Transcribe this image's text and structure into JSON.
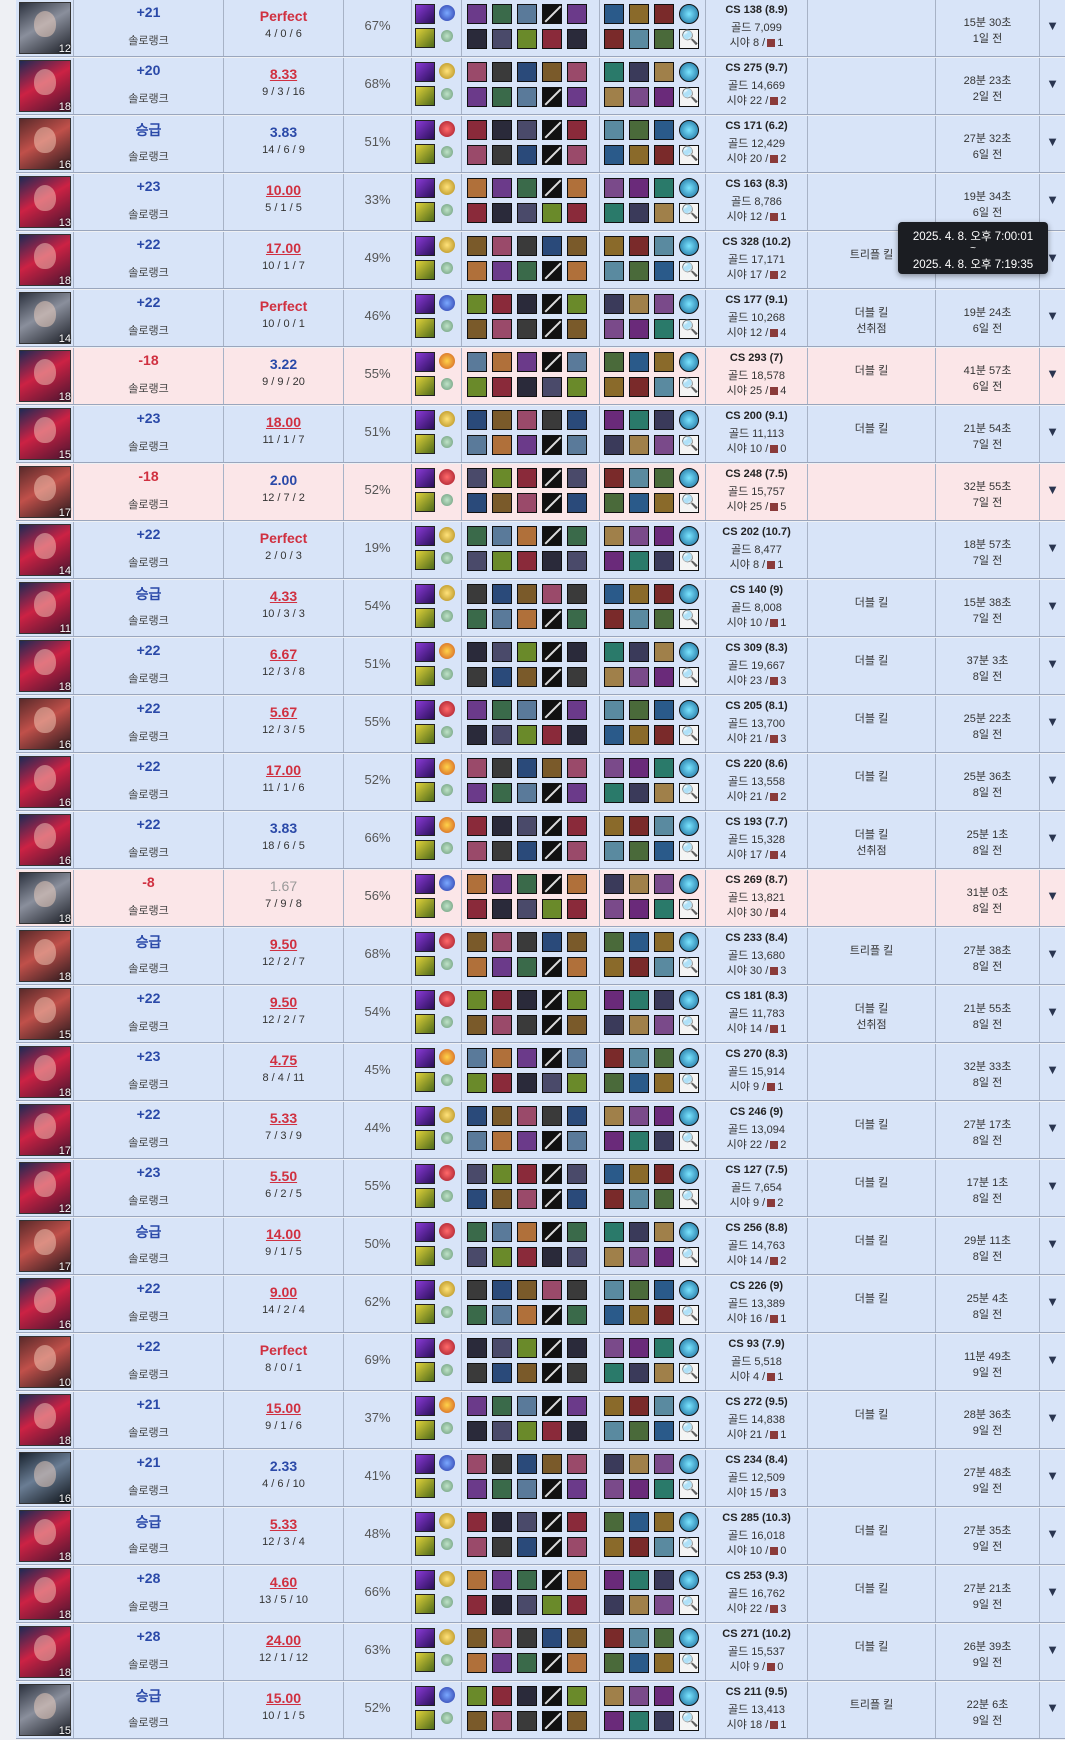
{
  "tooltip": {
    "start": "2025. 4. 8. 오후 7:00:01",
    "sep": "~",
    "end": "2025. 4. 8. 오후 7:19:35"
  },
  "colors": {
    "win_row": "#d8e4f8",
    "loss_row": "#fbe6e8",
    "lp_positive": "#2a49a8",
    "lp_negative": "#d03040",
    "kda_highlight": "#d03040"
  },
  "expand_icon": "▼",
  "matches": [
    {
      "result": "win",
      "champ": "lux",
      "level": "12",
      "lp": "+21",
      "queue": "솔로랭크",
      "kda_ratio": "Perfect",
      "kda_style": "perfect",
      "kda": "4 / 0 / 6",
      "kp": "67%",
      "rune": "sorcery",
      "cs": "CS 138 (8.9)",
      "gold": "골드 7,099",
      "vision": "시야 8 /",
      "wards": "1",
      "badge1": "",
      "badge2": "",
      "duration": "15분 30초",
      "ago": "1일 전"
    },
    {
      "result": "win",
      "champ": "zed",
      "level": "18",
      "lp": "+20",
      "queue": "솔로랭크",
      "kda_ratio": "8.33",
      "kda_style": "great",
      "kda": "9 / 3 / 16",
      "kp": "68%",
      "rune": "precision",
      "cs": "CS 275 (9.7)",
      "gold": "골드 14,669",
      "vision": "시야 22 /",
      "wards": "2",
      "badge1": "",
      "badge2": "",
      "duration": "28분 23초",
      "ago": "2일 전"
    },
    {
      "result": "win",
      "champ": "kat",
      "level": "16",
      "lp": "승급",
      "queue": "솔로랭크",
      "kda_ratio": "3.83",
      "kda_style": "normal",
      "kda": "14 / 6 / 9",
      "kp": "51%",
      "rune": "domination",
      "cs": "CS 171 (6.2)",
      "gold": "골드 12,429",
      "vision": "시야 20 /",
      "wards": "2",
      "badge1": "",
      "badge2": "",
      "duration": "27분 32초",
      "ago": "6일 전"
    },
    {
      "result": "win",
      "champ": "zed",
      "level": "13",
      "lp": "+23",
      "queue": "솔로랭크",
      "kda_ratio": "10.00",
      "kda_style": "great",
      "kda": "5 / 1 / 5",
      "kp": "33%",
      "rune": "precision",
      "cs": "CS 163 (8.3)",
      "gold": "골드 8,786",
      "vision": "시야 12 /",
      "wards": "1",
      "badge1": "",
      "badge2": "",
      "duration": "19분 34초",
      "ago": "6일 전"
    },
    {
      "result": "win",
      "champ": "zed",
      "level": "18",
      "lp": "+22",
      "queue": "솔로랭크",
      "kda_ratio": "17.00",
      "kda_style": "great",
      "kda": "10 / 1 / 7",
      "kp": "49%",
      "rune": "precision",
      "cs": "CS 328 (10.2)",
      "gold": "골드 17,171",
      "vision": "시야 17 /",
      "wards": "2",
      "badge1": "트리플 킬",
      "badge2": "",
      "duration": "",
      "ago": ""
    },
    {
      "result": "win",
      "champ": "lux",
      "level": "14",
      "lp": "+22",
      "queue": "솔로랭크",
      "kda_ratio": "Perfect",
      "kda_style": "perfect",
      "kda": "10 / 0 / 1",
      "kp": "46%",
      "rune": "sorcery",
      "cs": "CS 177 (9.1)",
      "gold": "골드 10,268",
      "vision": "시야 12 /",
      "wards": "4",
      "badge1": "더블 킬",
      "badge2": "선취점",
      "duration": "19분 24초",
      "ago": "6일 전"
    },
    {
      "result": "loss",
      "champ": "zed",
      "level": "18",
      "lp": "-18",
      "queue": "솔로랭크",
      "kda_ratio": "3.22",
      "kda_style": "normal",
      "kda": "9 / 9 / 20",
      "kp": "55%",
      "rune": "electro",
      "cs": "CS 293 (7)",
      "gold": "골드 18,578",
      "vision": "시야 25 /",
      "wards": "4",
      "badge1": "더블 킬",
      "badge2": "",
      "duration": "41분 57초",
      "ago": "6일 전"
    },
    {
      "result": "win",
      "champ": "zed",
      "level": "15",
      "lp": "+23",
      "queue": "솔로랭크",
      "kda_ratio": "18.00",
      "kda_style": "great",
      "kda": "11 / 1 / 7",
      "kp": "51%",
      "rune": "precision",
      "cs": "CS 200 (9.1)",
      "gold": "골드 11,113",
      "vision": "시야 10 /",
      "wards": "0",
      "badge1": "더블 킬",
      "badge2": "",
      "duration": "21분 54초",
      "ago": "7일 전"
    },
    {
      "result": "loss",
      "champ": "kat",
      "level": "17",
      "lp": "-18",
      "queue": "솔로랭크",
      "kda_ratio": "2.00",
      "kda_style": "normal",
      "kda": "12 / 7 / 2",
      "kp": "52%",
      "rune": "domination",
      "cs": "CS 248 (7.5)",
      "gold": "골드 15,757",
      "vision": "시야 25 /",
      "wards": "5",
      "badge1": "",
      "badge2": "",
      "duration": "32분 55초",
      "ago": "7일 전"
    },
    {
      "result": "win",
      "champ": "zed",
      "level": "14",
      "lp": "+22",
      "queue": "솔로랭크",
      "kda_ratio": "Perfect",
      "kda_style": "perfect",
      "kda": "2 / 0 / 3",
      "kp": "19%",
      "rune": "precision",
      "cs": "CS 202 (10.7)",
      "gold": "골드 8,477",
      "vision": "시야 8 /",
      "wards": "1",
      "badge1": "",
      "badge2": "",
      "duration": "18분 57초",
      "ago": "7일 전"
    },
    {
      "result": "win",
      "champ": "zed",
      "level": "11",
      "lp": "승급",
      "queue": "솔로랭크",
      "kda_ratio": "4.33",
      "kda_style": "great",
      "kda": "10 / 3 / 3",
      "kp": "54%",
      "rune": "precision",
      "cs": "CS 140 (9)",
      "gold": "골드 8,008",
      "vision": "시야 10 /",
      "wards": "1",
      "badge1": "더블 킬",
      "badge2": "",
      "duration": "15분 38초",
      "ago": "7일 전"
    },
    {
      "result": "win",
      "champ": "zed",
      "level": "18",
      "lp": "+22",
      "queue": "솔로랭크",
      "kda_ratio": "6.67",
      "kda_style": "great",
      "kda": "12 / 3 / 8",
      "kp": "51%",
      "rune": "electro",
      "cs": "CS 309 (8.3)",
      "gold": "골드 19,667",
      "vision": "시야 23 /",
      "wards": "3",
      "badge1": "더블 킬",
      "badge2": "",
      "duration": "37분 3초",
      "ago": "8일 전"
    },
    {
      "result": "win",
      "champ": "kat",
      "level": "16",
      "lp": "+22",
      "queue": "솔로랭크",
      "kda_ratio": "5.67",
      "kda_style": "great",
      "kda": "12 / 3 / 5",
      "kp": "55%",
      "rune": "domination",
      "cs": "CS 205 (8.1)",
      "gold": "골드 13,700",
      "vision": "시야 21 /",
      "wards": "3",
      "badge1": "더블 킬",
      "badge2": "",
      "duration": "25분 22초",
      "ago": "8일 전"
    },
    {
      "result": "win",
      "champ": "zed",
      "level": "16",
      "lp": "+22",
      "queue": "솔로랭크",
      "kda_ratio": "17.00",
      "kda_style": "great",
      "kda": "11 / 1 / 6",
      "kp": "52%",
      "rune": "electro",
      "cs": "CS 220 (8.6)",
      "gold": "골드 13,558",
      "vision": "시야 21 /",
      "wards": "2",
      "badge1": "더블 킬",
      "badge2": "",
      "duration": "25분 36초",
      "ago": "8일 전"
    },
    {
      "result": "win",
      "champ": "zed",
      "level": "16",
      "lp": "+22",
      "queue": "솔로랭크",
      "kda_ratio": "3.83",
      "kda_style": "normal",
      "kda": "18 / 6 / 5",
      "kp": "66%",
      "rune": "electro",
      "cs": "CS 193 (7.7)",
      "gold": "골드 15,328",
      "vision": "시야 17 /",
      "wards": "4",
      "badge1": "더블 킬",
      "badge2": "선취점",
      "duration": "25분 1초",
      "ago": "8일 전"
    },
    {
      "result": "loss",
      "champ": "lux",
      "level": "18",
      "lp": "-8",
      "queue": "솔로랭크",
      "kda_ratio": "1.67",
      "kda_style": "dim",
      "kda": "7 / 9 / 8",
      "kp": "56%",
      "rune": "sorcery",
      "cs": "CS 269 (8.7)",
      "gold": "골드 13,821",
      "vision": "시야 30 /",
      "wards": "4",
      "badge1": "",
      "badge2": "",
      "duration": "31분 0초",
      "ago": "8일 전"
    },
    {
      "result": "win",
      "champ": "kat",
      "level": "18",
      "lp": "승급",
      "queue": "솔로랭크",
      "kda_ratio": "9.50",
      "kda_style": "great",
      "kda": "12 / 2 / 7",
      "kp": "68%",
      "rune": "domination",
      "cs": "CS 233 (8.4)",
      "gold": "골드 13,680",
      "vision": "시야 30 /",
      "wards": "3",
      "badge1": "트리플 킬",
      "badge2": "",
      "duration": "27분 38초",
      "ago": "8일 전"
    },
    {
      "result": "win",
      "champ": "kat",
      "level": "15",
      "lp": "+22",
      "queue": "솔로랭크",
      "kda_ratio": "9.50",
      "kda_style": "great",
      "kda": "12 / 2 / 7",
      "kp": "54%",
      "rune": "domination",
      "cs": "CS 181 (8.3)",
      "gold": "골드 11,783",
      "vision": "시야 14 /",
      "wards": "1",
      "badge1": "더블 킬",
      "badge2": "선취점",
      "duration": "21분 55초",
      "ago": "8일 전"
    },
    {
      "result": "win",
      "champ": "zed",
      "level": "18",
      "lp": "+23",
      "queue": "솔로랭크",
      "kda_ratio": "4.75",
      "kda_style": "great",
      "kda": "8 / 4 / 11",
      "kp": "45%",
      "rune": "electro",
      "cs": "CS 270 (8.3)",
      "gold": "골드 15,914",
      "vision": "시야 9 /",
      "wards": "1",
      "badge1": "",
      "badge2": "",
      "duration": "32분 33초",
      "ago": "8일 전"
    },
    {
      "result": "win",
      "champ": "zed",
      "level": "17",
      "lp": "+22",
      "queue": "솔로랭크",
      "kda_ratio": "5.33",
      "kda_style": "great",
      "kda": "7 / 3 / 9",
      "kp": "44%",
      "rune": "precision",
      "cs": "CS 246 (9)",
      "gold": "골드 13,094",
      "vision": "시야 22 /",
      "wards": "2",
      "badge1": "더블 킬",
      "badge2": "",
      "duration": "27분 17초",
      "ago": "8일 전"
    },
    {
      "result": "win",
      "champ": "zed",
      "level": "12",
      "lp": "+23",
      "queue": "솔로랭크",
      "kda_ratio": "5.50",
      "kda_style": "great",
      "kda": "6 / 2 / 5",
      "kp": "55%",
      "rune": "domination",
      "cs": "CS 127 (7.5)",
      "gold": "골드 7,654",
      "vision": "시야 9 /",
      "wards": "2",
      "badge1": "더블 킬",
      "badge2": "",
      "duration": "17분 1초",
      "ago": "8일 전"
    },
    {
      "result": "win",
      "champ": "kat",
      "level": "17",
      "lp": "승급",
      "queue": "솔로랭크",
      "kda_ratio": "14.00",
      "kda_style": "great",
      "kda": "9 / 1 / 5",
      "kp": "50%",
      "rune": "domination",
      "cs": "CS 256 (8.8)",
      "gold": "골드 14,763",
      "vision": "시야 14 /",
      "wards": "2",
      "badge1": "더블 킬",
      "badge2": "",
      "duration": "29분 11초",
      "ago": "8일 전"
    },
    {
      "result": "win",
      "champ": "zed",
      "level": "16",
      "lp": "+22",
      "queue": "솔로랭크",
      "kda_ratio": "9.00",
      "kda_style": "great",
      "kda": "14 / 2 / 4",
      "kp": "62%",
      "rune": "precision",
      "cs": "CS 226 (9)",
      "gold": "골드 13,389",
      "vision": "시야 16 /",
      "wards": "1",
      "badge1": "더블 킬",
      "badge2": "",
      "duration": "25분 4초",
      "ago": "8일 전"
    },
    {
      "result": "win",
      "champ": "kat",
      "level": "10",
      "lp": "+22",
      "queue": "솔로랭크",
      "kda_ratio": "Perfect",
      "kda_style": "perfect",
      "kda": "8 / 0 / 1",
      "kp": "69%",
      "rune": "domination",
      "cs": "CS 93 (7.9)",
      "gold": "골드 5,518",
      "vision": "시야 4 /",
      "wards": "1",
      "badge1": "",
      "badge2": "",
      "duration": "11분 49초",
      "ago": "9일 전"
    },
    {
      "result": "win",
      "champ": "zed",
      "level": "18",
      "lp": "+21",
      "queue": "솔로랭크",
      "kda_ratio": "15.00",
      "kda_style": "great",
      "kda": "9 / 1 / 6",
      "kp": "37%",
      "rune": "electro",
      "cs": "CS 272 (9.5)",
      "gold": "골드 14,838",
      "vision": "시야 21 /",
      "wards": "1",
      "badge1": "더블 킬",
      "badge2": "",
      "duration": "28분 36초",
      "ago": "9일 전"
    },
    {
      "result": "win",
      "champ": "rob",
      "level": "16",
      "lp": "+21",
      "queue": "솔로랭크",
      "kda_ratio": "2.33",
      "kda_style": "normal",
      "kda": "4 / 6 / 10",
      "kp": "41%",
      "rune": "sorcery",
      "cs": "CS 234 (8.4)",
      "gold": "골드 12,509",
      "vision": "시야 15 /",
      "wards": "3",
      "badge1": "",
      "badge2": "",
      "duration": "27분 48초",
      "ago": "9일 전"
    },
    {
      "result": "win",
      "champ": "zed",
      "level": "18",
      "lp": "승급",
      "queue": "솔로랭크",
      "kda_ratio": "5.33",
      "kda_style": "great",
      "kda": "12 / 3 / 4",
      "kp": "48%",
      "rune": "precision",
      "cs": "CS 285 (10.3)",
      "gold": "골드 16,018",
      "vision": "시야 10 /",
      "wards": "0",
      "badge1": "더블 킬",
      "badge2": "",
      "duration": "27분 35초",
      "ago": "9일 전"
    },
    {
      "result": "win",
      "champ": "zed",
      "level": "18",
      "lp": "+28",
      "queue": "솔로랭크",
      "kda_ratio": "4.60",
      "kda_style": "great",
      "kda": "13 / 5 / 10",
      "kp": "66%",
      "rune": "precision",
      "cs": "CS 253 (9.3)",
      "gold": "골드 16,762",
      "vision": "시야 22 /",
      "wards": "3",
      "badge1": "더블 킬",
      "badge2": "",
      "duration": "27분 21초",
      "ago": "9일 전"
    },
    {
      "result": "win",
      "champ": "zed",
      "level": "18",
      "lp": "+28",
      "queue": "솔로랭크",
      "kda_ratio": "24.00",
      "kda_style": "great",
      "kda": "12 / 1 / 12",
      "kp": "63%",
      "rune": "precision",
      "cs": "CS 271 (10.2)",
      "gold": "골드 15,537",
      "vision": "시야 9 /",
      "wards": "0",
      "badge1": "더블 킬",
      "badge2": "",
      "duration": "26분 39초",
      "ago": "9일 전"
    },
    {
      "result": "win",
      "champ": "lux",
      "level": "15",
      "lp": "승급",
      "queue": "솔로랭크",
      "kda_ratio": "15.00",
      "kda_style": "great",
      "kda": "10 / 1 / 5",
      "kp": "52%",
      "rune": "sorcery",
      "cs": "CS 211 (9.5)",
      "gold": "골드 13,413",
      "vision": "시야 18 /",
      "wards": "1",
      "badge1": "트리플 킬",
      "badge2": "",
      "duration": "22분 6초",
      "ago": "9일 전"
    }
  ]
}
